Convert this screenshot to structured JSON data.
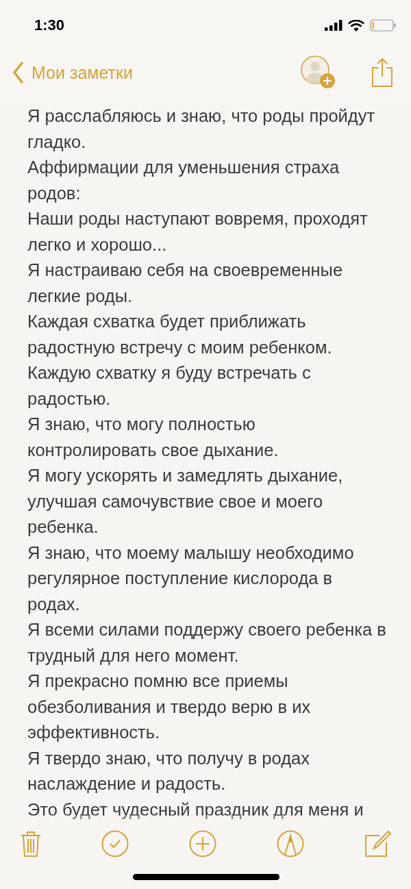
{
  "status_bar": {
    "time": "1:30"
  },
  "nav": {
    "back_label": "Мои заметки"
  },
  "note": {
    "paragraphs": [
      "Я расслабляюсь и знаю, что роды пройдут гладко.",
      "Аффирмации для уменьшения страха родов:",
      "Наши роды наступают вовремя, проходят легко и хорошо...",
      "Я настраиваю себя на своевременные легкие роды.",
      "Каждая схватка будет приближать радостную встречу с моим ребенком.",
      "Каждую схватку я буду встречать с радостью.",
      "Я знаю, что могу полностью контролировать свое дыхание.",
      "Я могу ускорять и замедлять дыхание, улучшая самочувствие свое и моего ребенка.",
      "Я знаю, что моему малышу необходимо регулярное поступление кислорода в родах.",
      "Я всеми силами поддержу своего ребенка в трудный для него момент.",
      "Я прекрасно помню все приемы обезболивания и твердо верю в их эффективность.",
      "Я твердо знаю, что получу в родах наслаждение и радость.",
      "Это будет чудесный праздник для меня и"
    ]
  }
}
